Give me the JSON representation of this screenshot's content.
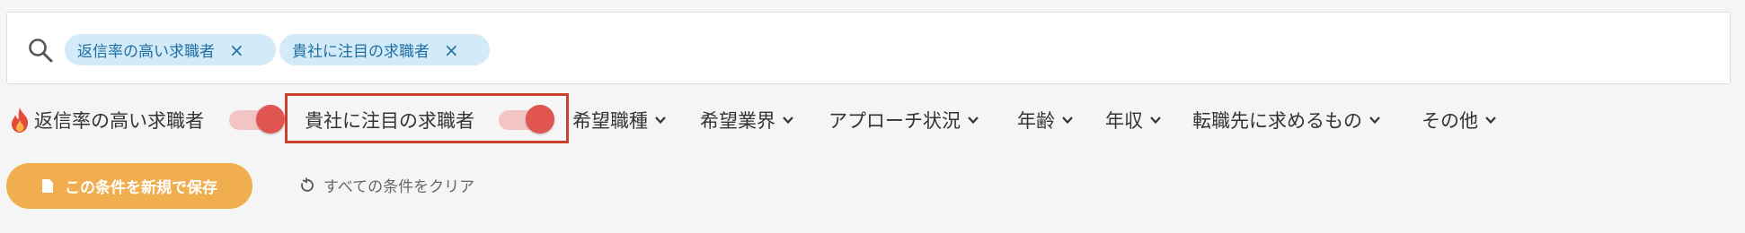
{
  "search": {
    "chips": [
      {
        "label": "返信率の高い求職者",
        "remove": "×"
      },
      {
        "label": "貴社に注目の求職者",
        "remove": "×"
      }
    ]
  },
  "filters": {
    "toggle1_label": "返信率の高い求職者",
    "toggle1_on": true,
    "toggle2_label": "貴社に注目の求職者",
    "toggle2_on": true,
    "dropdowns": [
      "希望職種",
      "希望業界",
      "アプローチ状況",
      "年齢",
      "年収",
      "転職先に求めるもの",
      "その他"
    ]
  },
  "actions": {
    "save_label": "この条件を新規で保存",
    "clear_label": "すべての条件をクリア"
  },
  "colors": {
    "chip_bg": "#d3eaf8",
    "toggle_on": "#e05550",
    "highlight_border": "#c9402f",
    "save_button": "#f0ae4f"
  }
}
